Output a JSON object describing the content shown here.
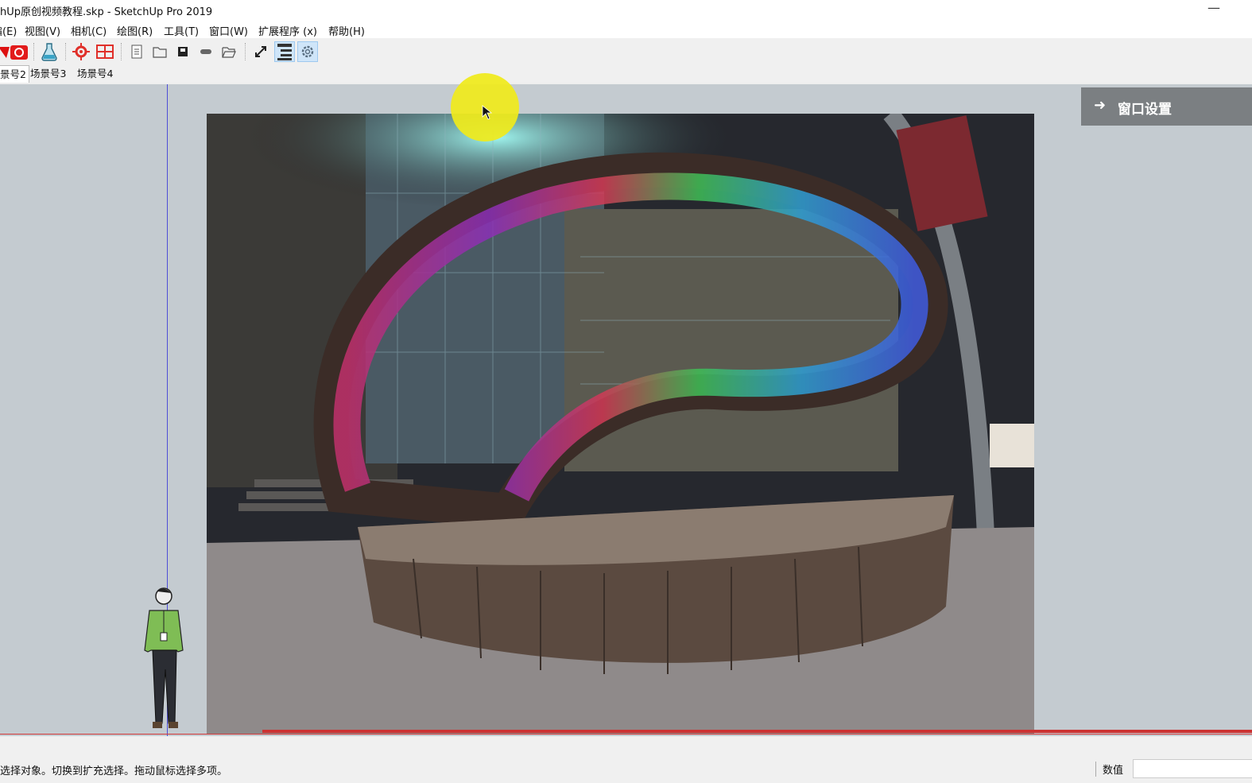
{
  "window": {
    "title": "hUp原创视频教程.skp - SketchUp Pro 2019",
    "minimize": "—"
  },
  "menu": [
    "編(E)",
    "视图(V)",
    "相机(C)",
    "绘图(R)",
    "工具(T)",
    "窗口(W)",
    "扩展程序 (x)",
    "帮助(H)"
  ],
  "toolbar_icons": [
    "ruby-icon",
    "camera-icon",
    "flask-icon",
    "sun-settings-icon",
    "section-grid-icon",
    "document-icon",
    "folder-icon",
    "save-icon",
    "tag-icon",
    "open-folder-icon",
    "zoom-extents-icon",
    "outliner-icon",
    "gear-icon"
  ],
  "scene_tabs": [
    "景号2",
    "场景号3",
    "场景号4"
  ],
  "tray": {
    "label": "窗口设置",
    "arrow": "➜"
  },
  "status": {
    "message": "选择对象。切换到扩充选择。拖动鼠标选择多项。",
    "value_label": "数值",
    "value": ""
  },
  "colors": {
    "viewport": "#c4cbd0",
    "cursor_highlight": "#f0ea1a",
    "red_axis": "#d23b3b",
    "blue_axis": "#4d4dd6"
  }
}
